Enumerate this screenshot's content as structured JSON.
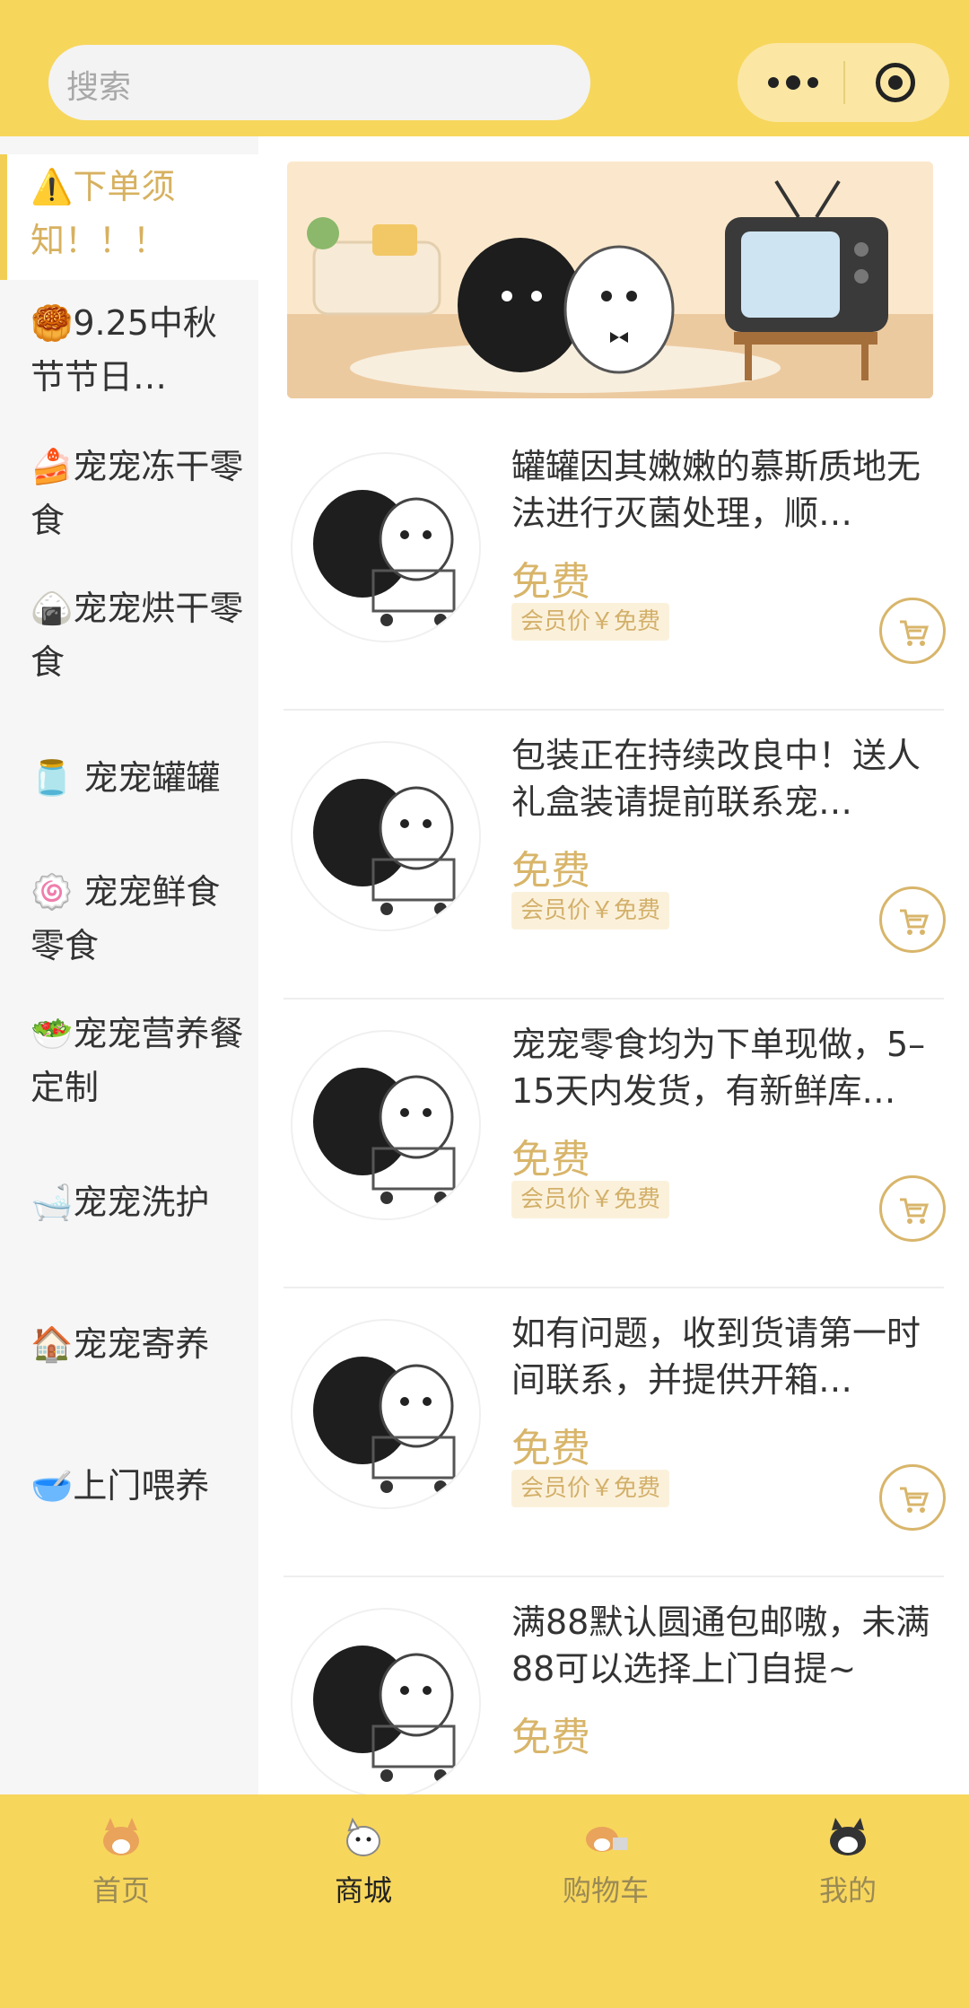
{
  "search": {
    "placeholder": "搜索"
  },
  "sidebar": {
    "items": [
      {
        "label": "⚠️下单须知！！！",
        "active": true
      },
      {
        "label": "🥮9.25中秋节节日…"
      },
      {
        "label": "🍰宠宠冻干零食"
      },
      {
        "label": "🍙宠宠烘干零食"
      },
      {
        "label": "🫙 宠宠罐罐"
      },
      {
        "label": "🍥 宠宠鲜食零食"
      },
      {
        "label": "🥗宠宠营养餐定制"
      },
      {
        "label": "🛁宠宠洗护"
      },
      {
        "label": "🏠宠宠寄养"
      },
      {
        "label": "🥣上门喂养"
      }
    ]
  },
  "products": [
    {
      "name": "罐罐因其嫩嫩的慕斯质地无法进行灭菌处理，顺…",
      "price": "免费",
      "member_price": "会员价￥免费"
    },
    {
      "name": "包装正在持续改良中！送人礼盒装请提前联系宠…",
      "price": "免费",
      "member_price": "会员价￥免费"
    },
    {
      "name": "宠宠零食均为下单现做，5–15天内发货，有新鲜库…",
      "price": "免费",
      "member_price": "会员价￥免费"
    },
    {
      "name": "如有问题，收到货请第一时间联系，并提供开箱…",
      "price": "免费",
      "member_price": "会员价￥免费"
    },
    {
      "name": "满88默认圆通包邮嗷，未满88可以选择上门自提~",
      "price": "免费",
      "member_price": ""
    }
  ],
  "tabbar": {
    "tabs": [
      {
        "label": "首页"
      },
      {
        "label": "商城",
        "active": true
      },
      {
        "label": "购物车"
      },
      {
        "label": "我的"
      }
    ]
  },
  "colors": {
    "brand_yellow": "#f7d65c",
    "price_gold": "#d8b56a"
  }
}
